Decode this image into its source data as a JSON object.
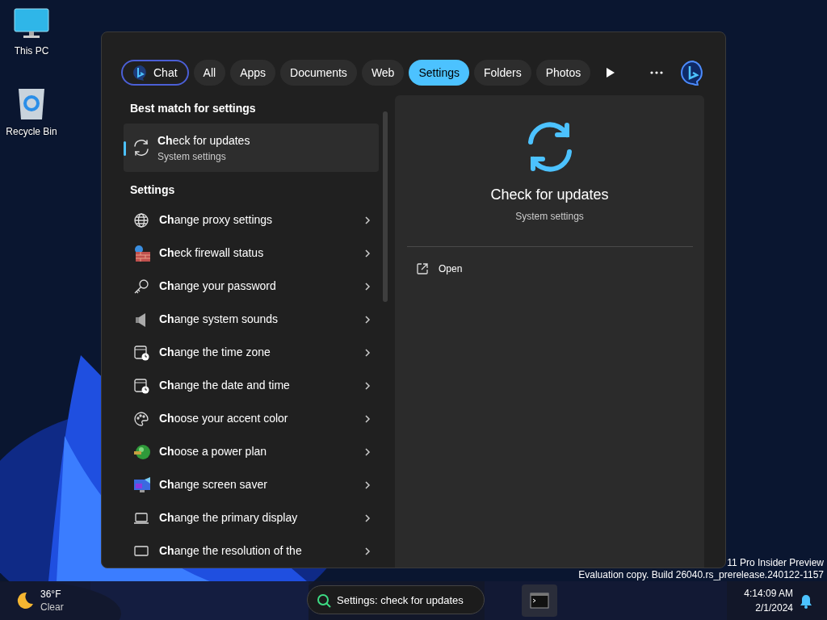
{
  "desktop_icons": [
    {
      "label": "This PC"
    },
    {
      "label": "Recycle Bin"
    }
  ],
  "search_panel": {
    "filters": [
      {
        "label": "Chat",
        "kind": "chat",
        "selected": false
      },
      {
        "label": "All",
        "kind": "filter",
        "selected": false
      },
      {
        "label": "Apps",
        "kind": "filter",
        "selected": false
      },
      {
        "label": "Documents",
        "kind": "filter",
        "selected": false
      },
      {
        "label": "Web",
        "kind": "filter",
        "selected": false
      },
      {
        "label": "Settings",
        "kind": "filter",
        "selected": true
      },
      {
        "label": "Folders",
        "kind": "filter",
        "selected": false
      },
      {
        "label": "Photos",
        "kind": "filter",
        "selected": false
      }
    ],
    "best_match": {
      "heading": "Best match for settings",
      "title": "**Ch**eck for updates",
      "subtitle": "System settings",
      "selected": true
    },
    "settings": {
      "heading": "Settings",
      "items": [
        {
          "label": "**Ch**ange proxy settings"
        },
        {
          "label": "**Ch**eck firewall status"
        },
        {
          "label": "**Ch**ange your password"
        },
        {
          "label": "**Ch**ange system sounds"
        },
        {
          "label": "**Ch**ange the time zone"
        },
        {
          "label": "**Ch**ange the date and time"
        },
        {
          "label": "**Ch**oose your accent color"
        },
        {
          "label": "**Ch**oose a power plan"
        },
        {
          "label": "**Ch**ange screen saver"
        },
        {
          "label": "**Ch**ange the primary display"
        },
        {
          "label": "**Ch**ange the resolution of the"
        }
      ]
    },
    "preview": {
      "title": "Check for updates",
      "subtitle": "System settings",
      "actions": [
        "Open"
      ]
    }
  },
  "watermark": [
    "11 Pro Insider Preview",
    "Evaluation copy. Build 26040.rs_prerelease.240122-1157"
  ],
  "taskbar": {
    "weather": {
      "temperature": "36°F",
      "condition": "Clear"
    },
    "search": {
      "value": "Settings: check for updates"
    },
    "clock": {
      "time": "4:14:09 AM",
      "date": "2/1/2024"
    }
  }
}
